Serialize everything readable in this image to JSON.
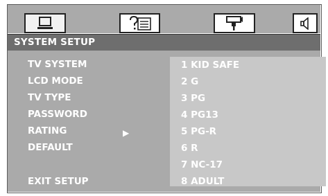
{
  "header": {
    "title": "SYSTEM SETUP",
    "tabs": [
      {
        "icon": "monitor-icon"
      },
      {
        "icon": "question-text-icon"
      },
      {
        "icon": "camera-icon"
      },
      {
        "icon": "speaker-icon"
      }
    ]
  },
  "menu": {
    "items": [
      {
        "label": "TV SYSTEM"
      },
      {
        "label": "LCD MODE"
      },
      {
        "label": "TV TYPE"
      },
      {
        "label": "PASSWORD"
      },
      {
        "label": "RATING"
      },
      {
        "label": "DEFAULT"
      },
      {
        "label": "EXIT SETUP"
      }
    ],
    "selected_indicator": "▶"
  },
  "rating_options": [
    {
      "label": "1 KID SAFE"
    },
    {
      "label": "2 G"
    },
    {
      "label": "3 PG"
    },
    {
      "label": "4 PG13"
    },
    {
      "label": "5 PG-R"
    },
    {
      "label": "6 R"
    },
    {
      "label": "7 NC-17"
    },
    {
      "label": "8 ADULT"
    }
  ],
  "colors": {
    "panel": "#aaaaaa",
    "title_band": "#6e6e6e",
    "options_panel": "#c8c8c8",
    "text": "#ffffff"
  }
}
